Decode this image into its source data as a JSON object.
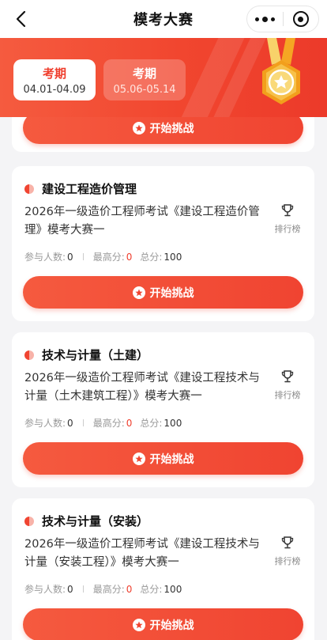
{
  "navbar": {
    "title": "模考大赛"
  },
  "periods": [
    {
      "label": "考期",
      "range": "04.01-04.09",
      "active": true
    },
    {
      "label": "考期",
      "range": "05.06-05.14",
      "active": false
    }
  ],
  "start_label": "开始挑战",
  "rank_label": "排行榜",
  "stats_labels": {
    "participants": "参与人数:",
    "highest": "最高分:",
    "total": "总分:"
  },
  "cards": [
    {
      "subject": "建设工程造价管理",
      "desc": "2026年一级造价工程师考试《建设工程造价管理》模考大赛一",
      "participants": "0",
      "highest": "0",
      "total": "100"
    },
    {
      "subject": "技术与计量（土建）",
      "desc": "2026年一级造价工程师考试《建设工程技术与计量（土木建筑工程）》模考大赛一",
      "participants": "0",
      "highest": "0",
      "total": "100"
    },
    {
      "subject": "技术与计量（安装）",
      "desc": "2026年一级造价工程师考试《建设工程技术与计量（安装工程）》模考大赛一",
      "participants": "0",
      "highest": "0",
      "total": "100"
    }
  ],
  "colors": {
    "accent": "#f04431",
    "header_bg": "#f1462f",
    "medal": "#f7b531"
  },
  "icons": [
    "back-icon",
    "more-icon",
    "close-icon",
    "medal-icon",
    "star-icon",
    "trophy-icon"
  ]
}
